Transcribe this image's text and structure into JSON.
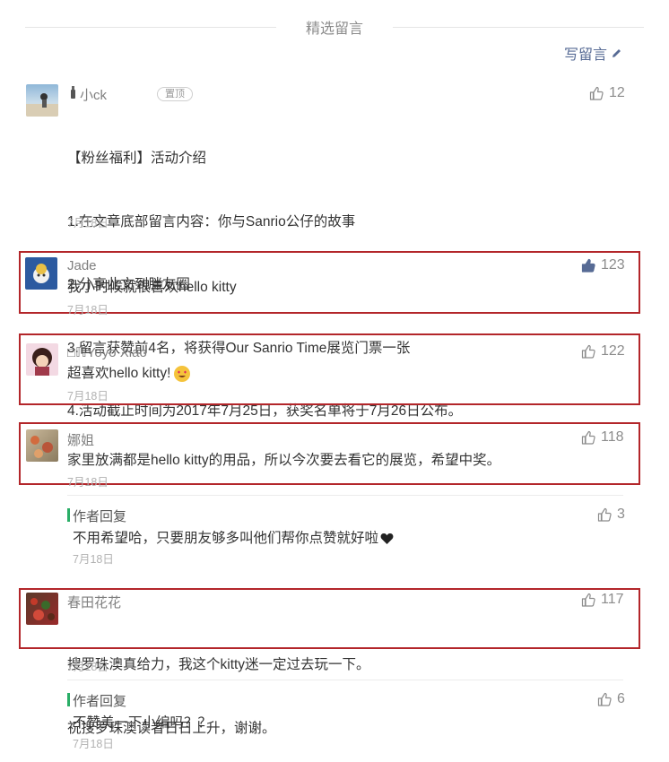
{
  "header": {
    "title": "精选留言",
    "write_label": "写留言"
  },
  "comments": [
    {
      "nickname": "小ck",
      "badge": "置顶",
      "likes": "12",
      "lines": [
        "【粉丝福利】活动介绍",
        "1.在文章底部留言内容：你与Sanrio公仔的故事",
        "2.分享此文到胖友圈",
        "3.留言获赞前4名，将获得Our Sanrio Time展览门票一张",
        "4.活动截止时间为2017年7月25日，获奖名单将于7月26日公布。"
      ],
      "date": "7月18日"
    },
    {
      "nickname": "Jade",
      "likes": "123",
      "liked": true,
      "lines": [
        "我小时候就很喜欢hello kitty"
      ],
      "date": "7月18日"
    },
    {
      "nickname": "□ℿYoyo Xiao",
      "likes": "122",
      "lines": [
        "超喜欢hello kitty!"
      ],
      "date": "7月18日"
    },
    {
      "nickname": "娜姐",
      "likes": "118",
      "lines": [
        "家里放满都是hello kitty的用品，所以今次要去看它的展览，希望中奖。"
      ],
      "date": "7月18日",
      "reply": {
        "label": "作者回复",
        "likes": "3",
        "text": "不用希望哈，只要朋友够多叫他们帮你点赞就好啦",
        "date": "7月18日"
      }
    },
    {
      "nickname": "春田花花",
      "likes": "117",
      "lines": [
        "搜罗珠澳真给力，我这个kitty迷一定过去玩一下。",
        "祝搜罗珠澳读者日日上升，谢谢。"
      ],
      "date": "7月18日",
      "reply": {
        "label": "作者回复",
        "likes": "6",
        "text": "不赞美一下小编吗？？",
        "date": "7月18日"
      }
    }
  ],
  "colors": {
    "link": "#576b95",
    "highlight_border": "#b3262a",
    "reply_bar": "#2aae67",
    "heart": "#222222"
  }
}
